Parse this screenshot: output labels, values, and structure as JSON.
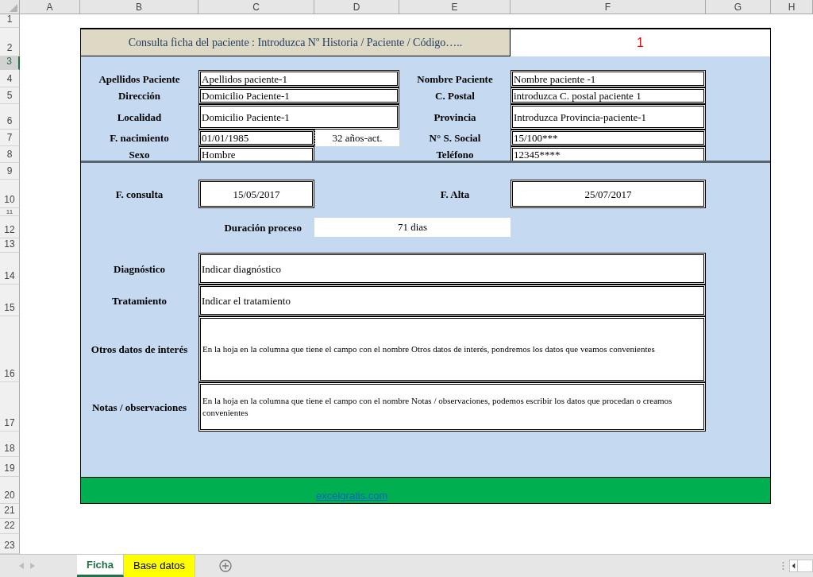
{
  "columns": [
    "A",
    "B",
    "C",
    "D",
    "E",
    "F",
    "G",
    "H"
  ],
  "rows": [
    {
      "label": "1",
      "selected": false
    },
    {
      "label": "2",
      "selected": false
    },
    {
      "label": "3",
      "selected": true
    },
    {
      "label": "4",
      "selected": false
    },
    {
      "label": "5",
      "selected": false
    },
    {
      "label": "6",
      "selected": false
    },
    {
      "label": "7",
      "selected": false
    },
    {
      "label": "8",
      "selected": false
    },
    {
      "label": "9",
      "selected": false
    },
    {
      "label": "10",
      "selected": false
    },
    {
      "label": "11",
      "selected": false
    },
    {
      "label": "12",
      "selected": false
    },
    {
      "label": "13",
      "selected": false
    },
    {
      "label": "14",
      "selected": false
    },
    {
      "label": "15",
      "selected": false
    },
    {
      "label": "16",
      "selected": false
    },
    {
      "label": "17",
      "selected": false
    },
    {
      "label": "18",
      "selected": false
    },
    {
      "label": "19",
      "selected": false
    },
    {
      "label": "20",
      "selected": false
    },
    {
      "label": "21",
      "selected": false
    },
    {
      "label": "22",
      "selected": false
    },
    {
      "label": "23",
      "selected": false
    }
  ],
  "header": {
    "prompt": "Consulta ficha del paciente : Introduzca Nº Historia / Paciente / Código…..",
    "code": "1"
  },
  "patient": [
    {
      "kind": "wide",
      "label": "Apellidos Paciente",
      "value": "Apellidos paciente-1",
      "right_label": "Nombre Paciente",
      "right_value": "Nombre paciente -1"
    },
    {
      "kind": "wide",
      "label": "Dirección",
      "value": "Domicilio Paciente-1",
      "right_label": "C. Postal",
      "right_value": "introduzca C. postal paciente 1"
    },
    {
      "kind": "wide",
      "label": "Localidad",
      "value": "Domicilio Paciente-1",
      "right_label": "Provincia",
      "right_value": "Introduzca Provincia-paciente-1"
    },
    {
      "kind": "with_age",
      "label": "F. nacimiento",
      "value": "01/01/1985",
      "age": "32 años-act.",
      "right_label": "N° S. Social",
      "right_value": "15/100***"
    },
    {
      "kind": "narrow",
      "label": "Sexo",
      "value": "Hombre",
      "right_label": "Teléfono",
      "right_value": "12345****"
    }
  ],
  "dates": {
    "consulta_label": "F. consulta",
    "consulta": "15/05/2017",
    "alta_label": "F. Alta",
    "alta": "25/07/2017",
    "duration_label": "Duración proceso",
    "duration": "71 dias"
  },
  "notes": [
    {
      "kind": "short",
      "label": "Diagnóstico",
      "value": "Indicar diagnóstico"
    },
    {
      "kind": "short",
      "label": "Tratamiento",
      "value": "Indicar el tratamiento"
    },
    {
      "kind": "long",
      "label": "Otros datos de interés",
      "value": "En la hoja en la columna que tiene el campo con el nombre Otros datos de interés, pondremos los datos que veamos convenientes"
    },
    {
      "kind": "long",
      "label": "Notas / observaciones",
      "value": "En la hoja en la columna que tiene el campo con el nombre Notas / observaciones, podemos escribir los datos que procedan o creamos convenientes"
    }
  ],
  "footer_link": "excelgratis.com",
  "sheet_tabs": [
    {
      "label": "Ficha",
      "selected": true,
      "color": "#ffffff"
    },
    {
      "label": "Base datos",
      "selected": false,
      "color": "#ffff00"
    }
  ]
}
